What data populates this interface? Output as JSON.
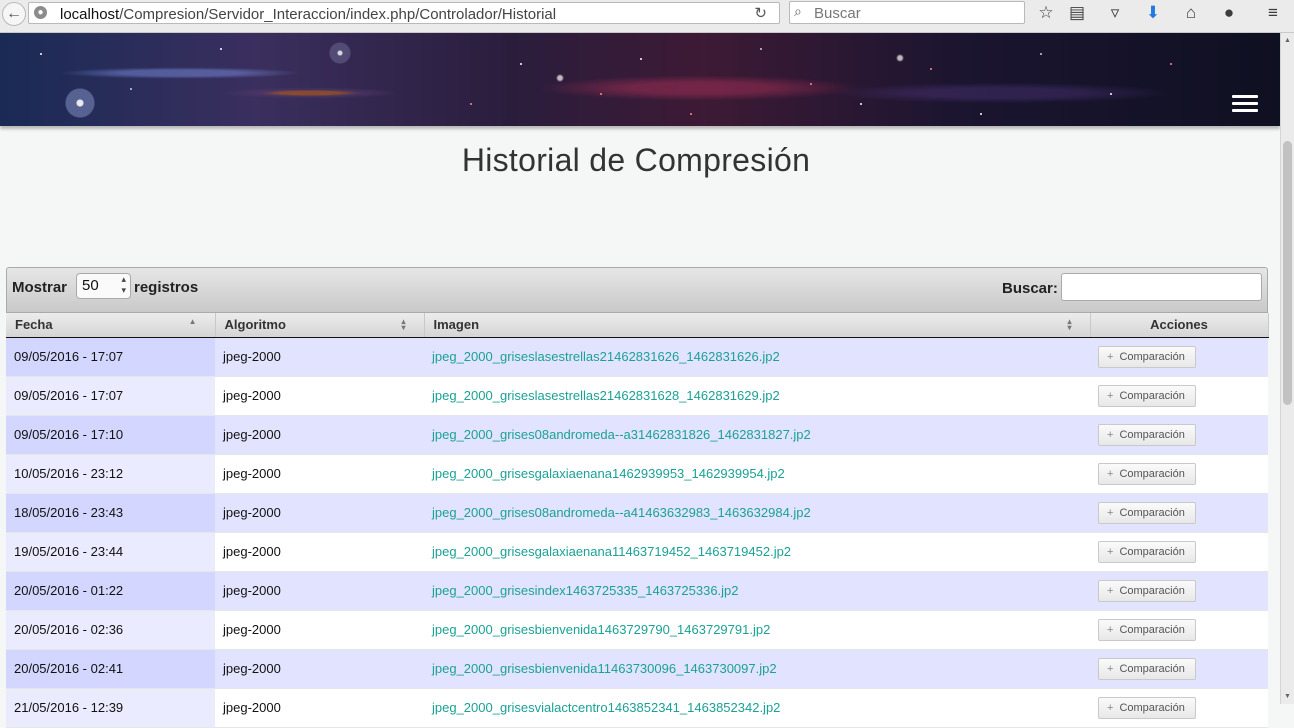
{
  "browser": {
    "url_host": "localhost",
    "url_path": "/Compresion/Servidor_Interaccion/index.php/Controlador/Historial",
    "search_placeholder": "Buscar"
  },
  "page": {
    "title": "Historial de Compresión"
  },
  "table_controls": {
    "show_label": "Mostrar",
    "page_length": "50",
    "records_label": "registros",
    "search_label": "Buscar:"
  },
  "table": {
    "columns": [
      "Fecha",
      "Algoritmo",
      "Imagen",
      "Acciones"
    ],
    "action_label": "Comparación",
    "rows": [
      {
        "fecha": "09/05/2016 - 17:07",
        "algoritmo": "jpeg-2000",
        "imagen": "jpeg_2000_griseslasestrellas21462831626_1462831626.jp2"
      },
      {
        "fecha": "09/05/2016 - 17:07",
        "algoritmo": "jpeg-2000",
        "imagen": "jpeg_2000_griseslasestrellas21462831628_1462831629.jp2"
      },
      {
        "fecha": "09/05/2016 - 17:10",
        "algoritmo": "jpeg-2000",
        "imagen": "jpeg_2000_grises08andromeda--a31462831826_1462831827.jp2"
      },
      {
        "fecha": "10/05/2016 - 23:12",
        "algoritmo": "jpeg-2000",
        "imagen": "jpeg_2000_grisesgalaxiaenana1462939953_1462939954.jp2"
      },
      {
        "fecha": "18/05/2016 - 23:43",
        "algoritmo": "jpeg-2000",
        "imagen": "jpeg_2000_grises08andromeda--a41463632983_1463632984.jp2"
      },
      {
        "fecha": "19/05/2016 - 23:44",
        "algoritmo": "jpeg-2000",
        "imagen": "jpeg_2000_grisesgalaxiaenana11463719452_1463719452.jp2"
      },
      {
        "fecha": "20/05/2016 - 01:22",
        "algoritmo": "jpeg-2000",
        "imagen": "jpeg_2000_grisesindex1463725335_1463725336.jp2"
      },
      {
        "fecha": "20/05/2016 - 02:36",
        "algoritmo": "jpeg-2000",
        "imagen": "jpeg_2000_grisesbienvenida1463729790_1463729791.jp2"
      },
      {
        "fecha": "20/05/2016 - 02:41",
        "algoritmo": "jpeg-2000",
        "imagen": "jpeg_2000_grisesbienvenida11463730096_1463730097.jp2"
      },
      {
        "fecha": "21/05/2016 - 12:39",
        "algoritmo": "jpeg-2000",
        "imagen": "jpeg_2000_grisesvialactcentro1463852341_1463852342.jp2"
      }
    ]
  }
}
